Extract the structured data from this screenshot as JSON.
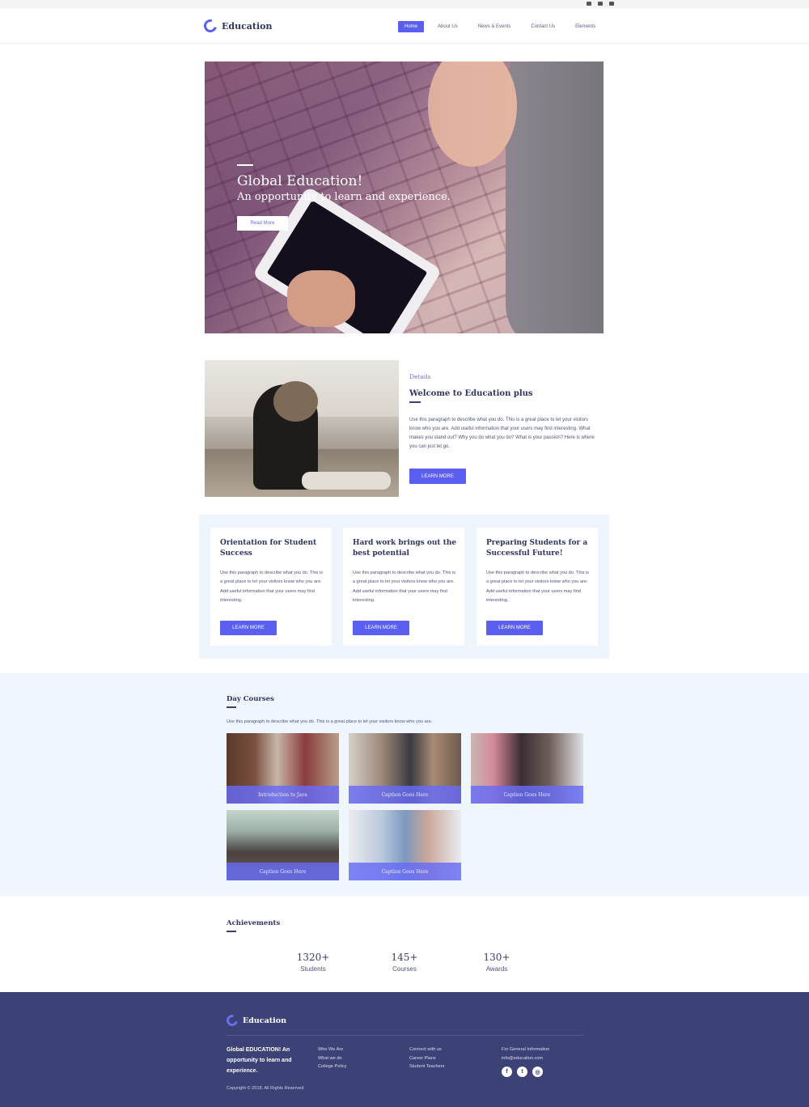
{
  "brand": {
    "name": "Education",
    "accent": "#5b5fef",
    "footer_bg": "#3c4176"
  },
  "nav": [
    {
      "label": "Home",
      "active": true
    },
    {
      "label": "About Us"
    },
    {
      "label": "News & Events"
    },
    {
      "label": "Contact Us"
    },
    {
      "label": "Elements"
    }
  ],
  "hero": {
    "title": "Global Education!",
    "subtitle": "An opportunity to learn and experience.",
    "button": "Read More"
  },
  "details": {
    "label": "Details",
    "title": "Welcome to Education plus",
    "paragraph": "Use this paragraph to describe what you do. This is a great place to let your visitors know who you are. Add useful information that your users may find interesting. What makes you stand out? Why you do what you do? What is your passion? Here is where you can just let go.",
    "button": "LEARN MORE"
  },
  "cards": [
    {
      "title": "Orientation for Student Success",
      "text": "Use this paragraph to describe what you do. This is a great place to let your visitors know who you are. Add useful information that your users may find interesting.",
      "button": "LEARN MORE"
    },
    {
      "title": "Hard work brings out the best potential",
      "text": "Use this paragraph to describe what you do. This is a great place to let your visitors know who you are. Add useful information that your users may find interesting.",
      "button": "LEARN MORE"
    },
    {
      "title": "Preparing Students for a Successful Future!",
      "text": "Use this paragraph to describe what you do. This is a great place to let your visitors know who you are. Add useful information that your users may find interesting.",
      "button": "LEARN MORE"
    }
  ],
  "courses": {
    "title": "Day Courses",
    "description": "Use this paragraph to describe what you do. This is a great place to let your visitors know who you are.",
    "tiles": [
      {
        "caption": "Introduction to Java"
      },
      {
        "caption": "Caption Goes Here"
      },
      {
        "caption": "Caption Goes Here"
      },
      {
        "caption": "Caption Goes Here"
      },
      {
        "caption": "Caption Goes Here"
      }
    ]
  },
  "achievements": {
    "title": "Achievements",
    "stats": [
      {
        "number": "1320+",
        "label": "Students"
      },
      {
        "number": "145+",
        "label": "Courses"
      },
      {
        "number": "130+",
        "label": "Awards"
      }
    ]
  },
  "footer": {
    "brand": "Education",
    "tagline": "Global EDUCATION! An opportunity to learn and experience.",
    "col1": [
      "Who We Are",
      "What we do",
      "College Policy"
    ],
    "col2": [
      "Connect with us",
      "Career Plans",
      "Student Teachers"
    ],
    "col3": [
      "For General Information",
      "info@education.com"
    ],
    "social": [
      {
        "icon": "facebook-icon",
        "glyph": "f"
      },
      {
        "icon": "twitter-icon",
        "glyph": "t"
      },
      {
        "icon": "instagram-icon",
        "glyph": "◎"
      }
    ],
    "copyright": "Copyright © 2018. All Rights Reserved"
  }
}
